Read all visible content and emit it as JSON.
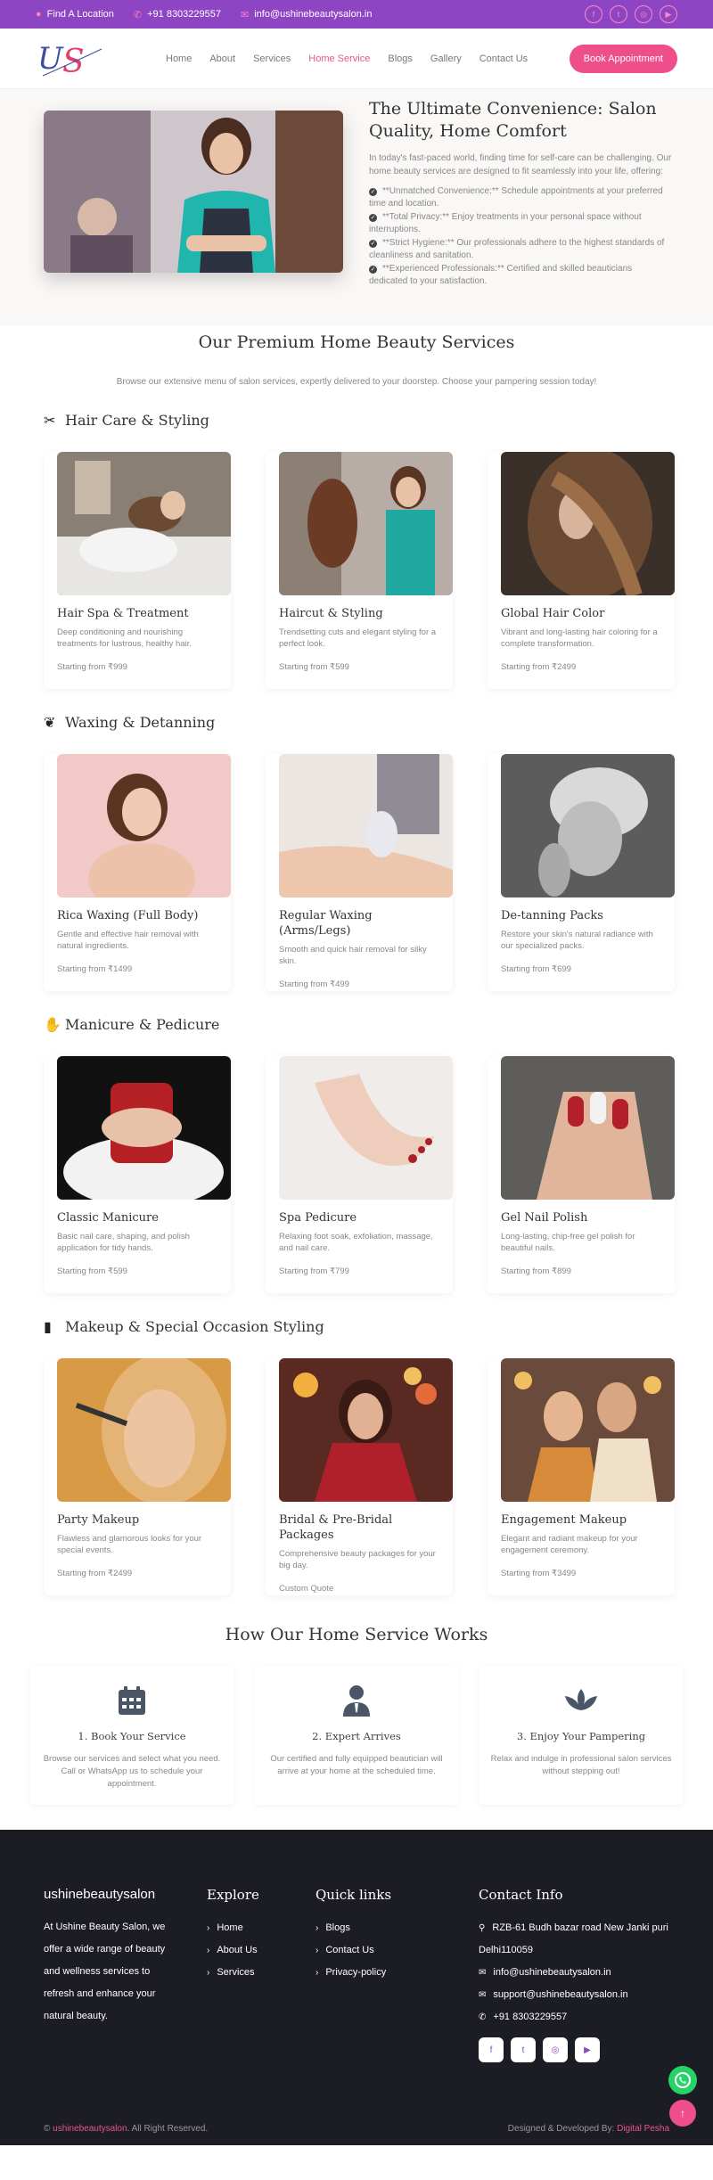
{
  "topbar": {
    "location": "Find A Location",
    "phone": "+91 8303229557",
    "email": "info@ushinebeautysalon.in"
  },
  "nav": {
    "logo_text": "US",
    "items": [
      "Home",
      "About",
      "Services",
      "Home Service",
      "Blogs",
      "Gallery",
      "Contact Us"
    ],
    "active": "Home Service",
    "cta": "Book Appointment"
  },
  "hero": {
    "title": "The Ultimate Convenience: Salon Quality, Home Comfort",
    "intro": "In today's fast-paced world, finding time for self-care can be challenging. Our home beauty services are designed to fit seamlessly into your life, offering:",
    "points": [
      "**Unmatched Convenience:** Schedule appointments at your preferred time and location.",
      "**Total Privacy:** Enjoy treatments in your personal space without interruptions.",
      "**Strict Hygiene:** Our professionals adhere to the highest standards of cleanliness and sanitation.",
      "**Experienced Professionals:** Certified and skilled beauticians dedicated to your satisfaction."
    ]
  },
  "services": {
    "title": "Our Premium Home Beauty Services",
    "subtitle": "Browse our extensive menu of salon services, expertly delivered to your doorstep. Choose your pampering session today!",
    "categories": [
      {
        "title": "Hair Care & Styling",
        "icon": "scissors-icon",
        "cards": [
          {
            "title": "Hair Spa & Treatment",
            "desc": "Deep conditioning and nourishing treatments for lustrous, healthy hair.",
            "price": "Starting from ₹999"
          },
          {
            "title": "Haircut & Styling",
            "desc": "Trendsetting cuts and elegant styling for a perfect look.",
            "price": "Starting from ₹599"
          },
          {
            "title": "Global Hair Color",
            "desc": "Vibrant and long-lasting hair coloring for a complete transformation.",
            "price": "Starting from ₹2499"
          }
        ]
      },
      {
        "title": "Waxing & Detanning",
        "icon": "spa-icon",
        "cards": [
          {
            "title": "Rica Waxing (Full Body)",
            "desc": "Gentle and effective hair removal with natural ingredients.",
            "price": "Starting from ₹1499"
          },
          {
            "title": "Regular Waxing (Arms/Legs)",
            "desc": "Smooth and quick hair removal for silky skin.",
            "price": "Starting from ₹499"
          },
          {
            "title": "De-tanning Packs",
            "desc": "Restore your skin's natural radiance with our specialized packs.",
            "price": "Starting from ₹699"
          }
        ]
      },
      {
        "title": "Manicure & Pedicure",
        "icon": "hand-icon",
        "cards": [
          {
            "title": "Classic Manicure",
            "desc": "Basic nail care, shaping, and polish application for tidy hands.",
            "price": "Starting from ₹599"
          },
          {
            "title": "Spa Pedicure",
            "desc": "Relaxing foot soak, exfoliation, massage, and nail care.",
            "price": "Starting from ₹799"
          },
          {
            "title": "Gel Nail Polish",
            "desc": "Long-lasting, chip-free gel polish for beautiful nails.",
            "price": "Starting from ₹899"
          }
        ]
      },
      {
        "title": "Makeup & Special Occasion Styling",
        "icon": "makeup-brush-icon",
        "cards": [
          {
            "title": "Party Makeup",
            "desc": "Flawless and glamorous looks for your special events.",
            "price": "Starting from ₹2499"
          },
          {
            "title": "Bridal & Pre-Bridal Packages",
            "desc": "Comprehensive beauty packages for your big day.",
            "price": "Custom Quote"
          },
          {
            "title": "Engagement Makeup",
            "desc": "Elegant and radiant makeup for your engagement ceremony.",
            "price": "Starting from ₹3499"
          }
        ]
      }
    ]
  },
  "how": {
    "title": "How Our Home Service Works",
    "steps": [
      {
        "title": "1. Book Your Service",
        "desc": "Browse our services and select what you need. Call or WhatsApp us to schedule your appointment.",
        "icon": "calendar-icon"
      },
      {
        "title": "2. Expert Arrives",
        "desc": "Our certified and fully equipped beautician will arrive at your home at the scheduled time.",
        "icon": "user-tie-icon"
      },
      {
        "title": "3. Enjoy Your Pampering",
        "desc": "Relax and indulge in professional salon services without stepping out!",
        "icon": "lotus-icon"
      }
    ]
  },
  "footer": {
    "brand": "ushinebeautysalon",
    "about": "At Ushine Beauty Salon, we offer a wide range of beauty and wellness services to refresh and enhance your natural beauty.",
    "explore_title": "Explore",
    "explore": [
      "Home",
      "About Us",
      "Services"
    ],
    "quick_title": "Quick links",
    "quick": [
      "Blogs",
      "Contact Us",
      "Privacy-policy"
    ],
    "contact_title": "Contact Info",
    "address": "RZB-61 Budh bazar road New Janki puri Delhi110059",
    "email1": "info@ushinebeautysalon.in",
    "email2": "support@ushinebeautysalon.in",
    "phone": "+91 8303229557",
    "copy_brand": "ushinebeautysalon",
    "copy_rest": ". All Right Reserved.",
    "dev_prefix": "Designed & Developed By: ",
    "dev_name": "Digital Pesha"
  }
}
